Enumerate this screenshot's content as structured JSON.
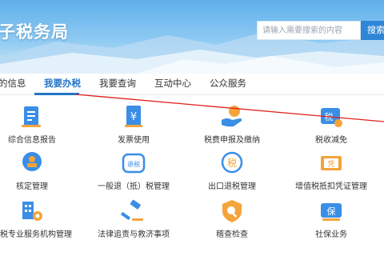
{
  "header": {
    "title": "子税务局",
    "search": {
      "placeholder": "请输入需要搜索的内容",
      "button_label": "搜索"
    }
  },
  "nav": {
    "items": [
      "的信息",
      "我要办税",
      "我要查询",
      "互动中心",
      "公众服务"
    ],
    "active_index": 1
  },
  "tiles": [
    {
      "label": "综合信息报告",
      "icon": "report-icon"
    },
    {
      "label": "发票使用",
      "icon": "invoice-icon"
    },
    {
      "label": "税费申报及缴纳",
      "icon": "tax-declare-icon"
    },
    {
      "label": "税收减免",
      "icon": "tax-reduction-icon"
    },
    {
      "label": "核定管理",
      "icon": "assessment-stamp-icon"
    },
    {
      "label": "一般退（抵）税管理",
      "icon": "refund-icon"
    },
    {
      "label": "出口退税管理",
      "icon": "export-refund-icon"
    },
    {
      "label": "增值税抵扣凭证管理",
      "icon": "voucher-icon"
    },
    {
      "label": "涉税专业服务机构管理",
      "icon": "agency-building-icon"
    },
    {
      "label": "法律追责与救济事项",
      "icon": "legal-gavel-icon"
    },
    {
      "label": "稽查检查",
      "icon": "inspection-shield-icon"
    },
    {
      "label": "社保业务",
      "icon": "social-security-icon"
    }
  ],
  "icon_texts": {
    "tax": "税",
    "refund": "退税",
    "voucher": "凭",
    "social": "保"
  },
  "colors": {
    "brand_blue": "#2274c8",
    "icon_blue": "#3a8ee6",
    "icon_orange": "#f3a43b",
    "annotation_red": "#e0201b"
  }
}
